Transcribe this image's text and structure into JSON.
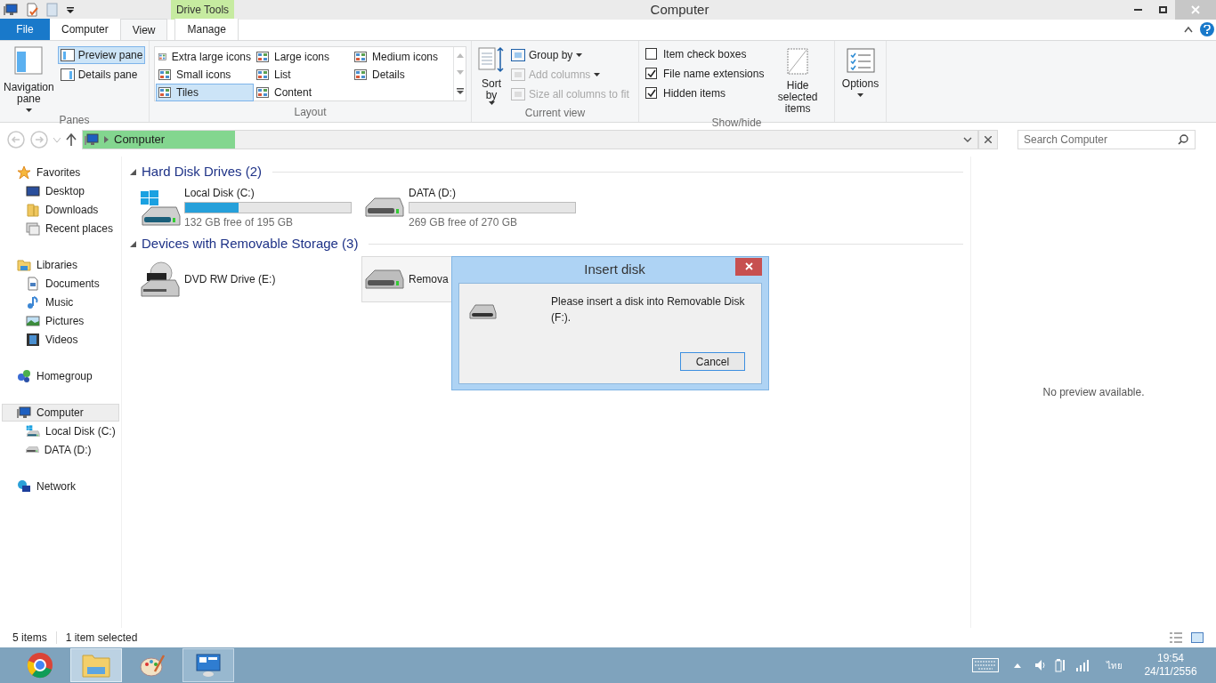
{
  "window": {
    "title": "Computer"
  },
  "contextual_tab_group": {
    "label": "Drive Tools"
  },
  "tabs": [
    {
      "label": "File",
      "kind": "file",
      "selected": false
    },
    {
      "label": "Computer",
      "kind": "tab",
      "selected": false
    },
    {
      "label": "View",
      "kind": "tab",
      "selected": true
    },
    {
      "label": "Manage",
      "kind": "tab",
      "selected": false
    }
  ],
  "ribbon": {
    "panes": {
      "label": "Panes",
      "navigation_pane": "Navigation pane",
      "items": [
        {
          "label": "Preview pane",
          "selected": true
        },
        {
          "label": "Details pane",
          "selected": false
        }
      ]
    },
    "layout": {
      "label": "Layout",
      "options": [
        {
          "label": "Extra large icons",
          "selected": false
        },
        {
          "label": "Large icons",
          "selected": false
        },
        {
          "label": "Medium icons",
          "selected": false
        },
        {
          "label": "Small icons",
          "selected": false
        },
        {
          "label": "List",
          "selected": false
        },
        {
          "label": "Details",
          "selected": false
        },
        {
          "label": "Tiles",
          "selected": true
        },
        {
          "label": "Content",
          "selected": false
        }
      ]
    },
    "current_view": {
      "label": "Current view",
      "sort_by": "Sort by",
      "items": [
        {
          "label": "Group by",
          "disabled": false
        },
        {
          "label": "Add columns",
          "disabled": true
        },
        {
          "label": "Size all columns to fit",
          "disabled": true
        }
      ]
    },
    "show_hide": {
      "label": "Show/hide",
      "checkboxes": [
        {
          "label": "Item check boxes",
          "checked": false
        },
        {
          "label": "File name extensions",
          "checked": true
        },
        {
          "label": "Hidden items",
          "checked": true
        }
      ],
      "hide_selected": "Hide selected items"
    },
    "options": {
      "label": "Options"
    }
  },
  "address": {
    "path": [
      "Computer"
    ],
    "level": 0.17
  },
  "search": {
    "placeholder": "Search Computer"
  },
  "nav_pane": [
    {
      "label": "Favorites",
      "kind": "star",
      "selected": false,
      "children": [
        {
          "label": "Desktop",
          "kind": "desktop",
          "selected": false
        },
        {
          "label": "Downloads",
          "kind": "folder",
          "selected": false
        },
        {
          "label": "Recent places",
          "kind": "recent",
          "selected": false
        }
      ]
    },
    {
      "label": "Libraries",
      "kind": "library",
      "selected": false,
      "children": [
        {
          "label": "Documents",
          "kind": "document",
          "selected": false
        },
        {
          "label": "Music",
          "kind": "music",
          "selected": false
        },
        {
          "label": "Pictures",
          "kind": "picture",
          "selected": false
        },
        {
          "label": "Videos",
          "kind": "video",
          "selected": false
        }
      ]
    },
    {
      "label": "Homegroup",
      "kind": "homegroup",
      "selected": false
    },
    {
      "label": "Computer",
      "kind": "computer",
      "selected": true,
      "children": [
        {
          "label": "Local Disk (C:)",
          "kind": "system_drive",
          "selected": false
        },
        {
          "label": "DATA (D:)",
          "kind": "drive",
          "selected": false
        }
      ]
    },
    {
      "label": "Network",
      "kind": "network",
      "selected": false
    }
  ],
  "content": [
    {
      "title": "Hard Disk Drives (2)",
      "expanded": true,
      "items": [
        {
          "name": "Local Disk (C:)",
          "kind": "system_drive",
          "selected": false,
          "level": 0.32,
          "reading": "132 GB free of 195 GB"
        },
        {
          "name": "DATA (D:)",
          "kind": "drive",
          "selected": false,
          "level": 0.0,
          "reading": "269 GB free of 270 GB"
        }
      ]
    },
    {
      "title": "Devices with Removable Storage (3)",
      "expanded": true,
      "items": [
        {
          "name": "DVD RW Drive (E:)",
          "kind": "dvd",
          "selected": false
        },
        {
          "name": "Remova",
          "kind": "removable",
          "selected": true
        }
      ]
    }
  ],
  "preview": {
    "message": "No preview available."
  },
  "status_bar": {
    "items": "5 items",
    "selection": "1 item selected"
  },
  "dialog": {
    "title": "Insert disk",
    "message": "Please insert a disk into Removable Disk (F:).",
    "button": "Cancel"
  },
  "taskbar": {
    "apps": [
      {
        "kind": "browser",
        "selected": false
      },
      {
        "kind": "explorer",
        "selected": true
      },
      {
        "kind": "paint",
        "selected": false
      },
      {
        "kind": "remote",
        "selected": true
      }
    ],
    "language": "ไทย",
    "time": "19:54",
    "date": "24/11/2556"
  }
}
